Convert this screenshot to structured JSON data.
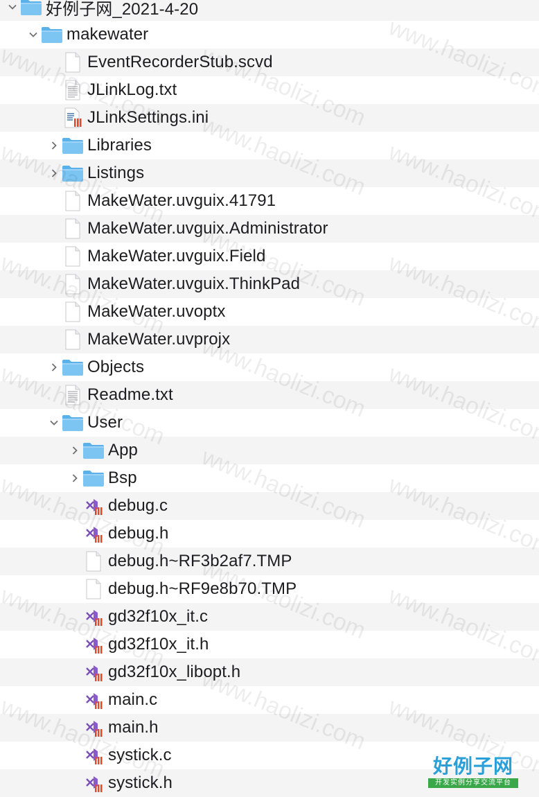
{
  "watermark_text": "www.haolizi.com",
  "brand": {
    "title": "好例子网",
    "subtitle": "开发实例分享交流平台"
  },
  "items": [
    {
      "label": "好例子网_2021-4-20",
      "level": 0,
      "kind": "folder",
      "expanded": true
    },
    {
      "label": "makewater",
      "level": 1,
      "kind": "folder",
      "expanded": true
    },
    {
      "label": "EventRecorderStub.scvd",
      "level": 2,
      "kind": "blank"
    },
    {
      "label": "JLinkLog.txt",
      "level": 2,
      "kind": "text"
    },
    {
      "label": "JLinkSettings.ini",
      "level": 2,
      "kind": "ini"
    },
    {
      "label": "Libraries",
      "level": 2,
      "kind": "folder",
      "expanded": false
    },
    {
      "label": "Listings",
      "level": 2,
      "kind": "folder",
      "expanded": false
    },
    {
      "label": "MakeWater.uvguix.41791",
      "level": 2,
      "kind": "blank"
    },
    {
      "label": "MakeWater.uvguix.Administrator",
      "level": 2,
      "kind": "blank"
    },
    {
      "label": "MakeWater.uvguix.Field",
      "level": 2,
      "kind": "blank"
    },
    {
      "label": "MakeWater.uvguix.ThinkPad",
      "level": 2,
      "kind": "blank"
    },
    {
      "label": "MakeWater.uvoptx",
      "level": 2,
      "kind": "blank"
    },
    {
      "label": "MakeWater.uvprojx",
      "level": 2,
      "kind": "blank"
    },
    {
      "label": "Objects",
      "level": 2,
      "kind": "folder",
      "expanded": false
    },
    {
      "label": "Readme.txt",
      "level": 2,
      "kind": "text"
    },
    {
      "label": "User",
      "level": 2,
      "kind": "folder",
      "expanded": true
    },
    {
      "label": "App",
      "level": 3,
      "kind": "folder",
      "expanded": false
    },
    {
      "label": "Bsp",
      "level": 3,
      "kind": "folder",
      "expanded": false
    },
    {
      "label": "debug.c",
      "level": 3,
      "kind": "vs"
    },
    {
      "label": "debug.h",
      "level": 3,
      "kind": "vs"
    },
    {
      "label": "debug.h~RF3b2af7.TMP",
      "level": 3,
      "kind": "blank"
    },
    {
      "label": "debug.h~RF9e8b70.TMP",
      "level": 3,
      "kind": "blank"
    },
    {
      "label": "gd32f10x_it.c",
      "level": 3,
      "kind": "vs"
    },
    {
      "label": "gd32f10x_it.h",
      "level": 3,
      "kind": "vs"
    },
    {
      "label": "gd32f10x_libopt.h",
      "level": 3,
      "kind": "vs"
    },
    {
      "label": "main.c",
      "level": 3,
      "kind": "vs"
    },
    {
      "label": "main.h",
      "level": 3,
      "kind": "vs"
    },
    {
      "label": "systick.c",
      "level": 3,
      "kind": "vs"
    },
    {
      "label": "systick.h",
      "level": 3,
      "kind": "vs"
    }
  ]
}
